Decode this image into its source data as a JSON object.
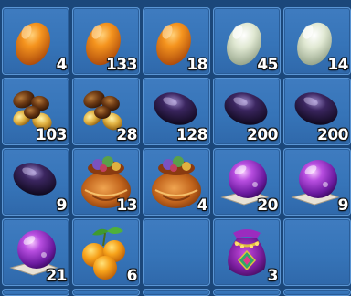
{
  "inventory": {
    "slots": [
      {
        "item": "orange-egg",
        "qty": "4"
      },
      {
        "item": "orange-egg",
        "qty": "133"
      },
      {
        "item": "orange-egg",
        "qty": "18"
      },
      {
        "item": "pale-green-egg",
        "qty": "45"
      },
      {
        "item": "pale-green-egg",
        "qty": "14"
      },
      {
        "item": "brown-beans",
        "qty": "103"
      },
      {
        "item": "brown-beans",
        "qty": "28"
      },
      {
        "item": "dark-purple-egg",
        "qty": "128"
      },
      {
        "item": "dark-purple-egg",
        "qty": "200"
      },
      {
        "item": "dark-purple-egg",
        "qty": "200"
      },
      {
        "item": "dark-purple-egg",
        "qty": "9"
      },
      {
        "item": "treasure-sack",
        "qty": "13"
      },
      {
        "item": "treasure-sack",
        "qty": "4"
      },
      {
        "item": "purple-orb-on-scroll",
        "qty": "20"
      },
      {
        "item": "purple-orb-on-scroll",
        "qty": "9"
      },
      {
        "item": "purple-orb-on-scroll",
        "qty": "21"
      },
      {
        "item": "orange-fruits",
        "qty": "6"
      },
      {
        "item": "empty",
        "qty": ""
      },
      {
        "item": "purple-pouch",
        "qty": "3"
      },
      {
        "item": "empty",
        "qty": ""
      }
    ]
  },
  "colors": {
    "background": "#1b477a",
    "slot": "#3674b8",
    "slot_border": "#5a95d4",
    "quantity_text": "#ffffff"
  }
}
